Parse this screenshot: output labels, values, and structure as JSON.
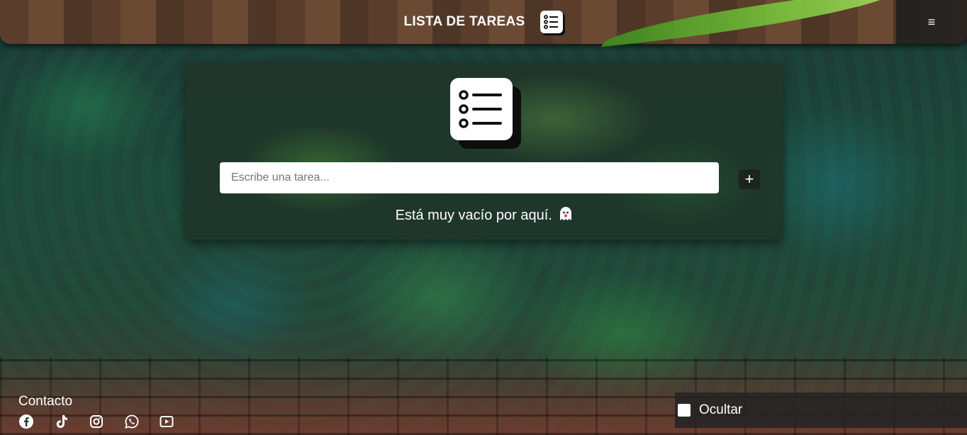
{
  "header": {
    "title": "LISTA DE TAREAS",
    "logo_icon": "task-list-icon",
    "menu_icon": "hamburger-icon",
    "menu_glyph": "≡"
  },
  "card": {
    "icon": "task-list-icon",
    "input_placeholder": "Escribe una tarea...",
    "input_value": "",
    "add_button_label": "+",
    "empty_message": "Está muy vacío por aquí.",
    "empty_icon": "ghost-icon"
  },
  "footer": {
    "contact_title": "Contacto",
    "social": [
      "facebook-icon",
      "tiktok-icon",
      "instagram-icon",
      "whatsapp-icon",
      "youtube-icon"
    ],
    "toggle_label": "Ocultar",
    "toggle_checked": false
  },
  "colors": {
    "header_wood": "#5a3e2b",
    "card_bg": "#203428",
    "button_bg": "#1c2420",
    "text": "#ffffff"
  }
}
